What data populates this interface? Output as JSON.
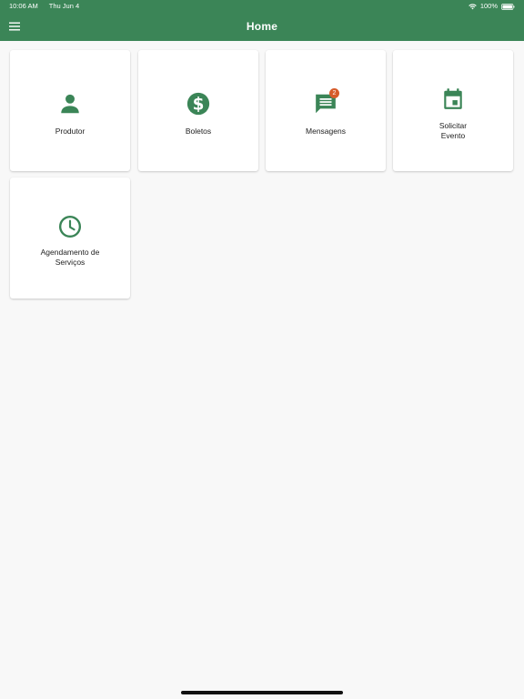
{
  "status_bar": {
    "time": "10:06 AM",
    "date": "Thu Jun 4",
    "battery": "100%"
  },
  "app_bar": {
    "title": "Home",
    "menu_icon": "hamburger-menu-icon"
  },
  "colors": {
    "primary": "#3b8557",
    "badge": "#d65b2a",
    "background": "#f8f8f8"
  },
  "tiles": [
    {
      "label": "Produtor",
      "icon": "person-icon"
    },
    {
      "label": "Boletos",
      "icon": "dollar-coin-icon"
    },
    {
      "label": "Mensagens",
      "icon": "message-icon",
      "badge": "2"
    },
    {
      "label": "Solicitar\nEvento",
      "icon": "calendar-icon"
    },
    {
      "label": "Agendamento de\nServiços",
      "icon": "clock-icon"
    }
  ]
}
